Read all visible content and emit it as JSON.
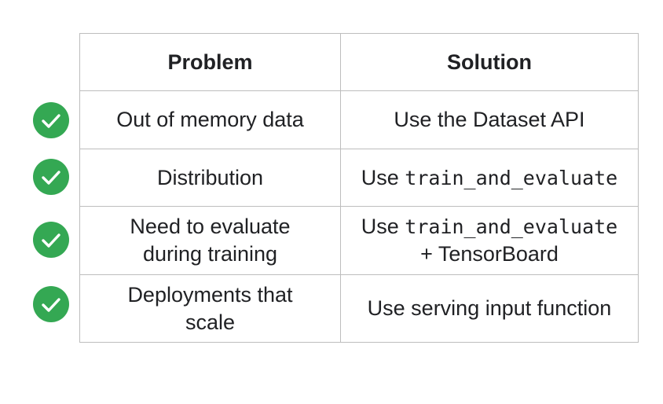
{
  "header": {
    "problem": "Problem",
    "solution": "Solution"
  },
  "rows": [
    {
      "problem_line1": "Out of memory data",
      "problem_line2": "",
      "solution_prefix": "Use the Dataset API",
      "solution_code": "",
      "solution_line2": "",
      "check_icon": "check-circle-icon"
    },
    {
      "problem_line1": "Distribution",
      "problem_line2": "",
      "solution_prefix": "Use ",
      "solution_code": "train_and_evaluate",
      "solution_line2": "",
      "check_icon": "check-circle-icon"
    },
    {
      "problem_line1": "Need to evaluate",
      "problem_line2": "during training",
      "solution_prefix": "Use ",
      "solution_code": "train_and_evaluate",
      "solution_line2": "+ TensorBoard",
      "check_icon": "check-circle-icon"
    },
    {
      "problem_line1": "Deployments that",
      "problem_line2": "scale",
      "solution_prefix": "Use serving input function",
      "solution_code": "",
      "solution_line2": "",
      "check_icon": "check-circle-icon"
    }
  ],
  "colors": {
    "check_green": "#34a853",
    "border": "#bdbdbd",
    "text": "#202124"
  }
}
